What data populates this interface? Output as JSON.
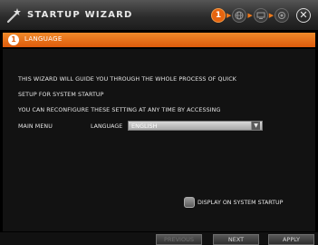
{
  "window": {
    "title": "STARTUP WIZARD",
    "close_symbol": "✕"
  },
  "steps": [
    {
      "label": "1",
      "icon": "step-1-icon",
      "active": true
    },
    {
      "icon": "globe-icon",
      "active": false
    },
    {
      "icon": "monitor-icon",
      "active": false
    },
    {
      "icon": "record-icon",
      "active": false
    }
  ],
  "section": {
    "badge": "1",
    "title": "LANGUAGE"
  },
  "description": [
    "THIS WIZARD WILL GUIDE YOU THROUGH THE WHOLE PROCESS OF QUICK",
    "SETUP FOR SYSTEM STARTUP",
    "YOU CAN RECONFIGURE THESE SETTING AT ANY TIME BY ACCESSING",
    "MAIN MENU"
  ],
  "language": {
    "label": "LANGUAGE",
    "value": "ENGLISH",
    "dropdown_symbol": "▼"
  },
  "startup_option": {
    "label": "DISPLAY ON SYSTEM STARTUP"
  },
  "buttons": {
    "previous": "PREVIOUS",
    "next": "NEXT",
    "apply": "APPLY"
  },
  "colors": {
    "accent": "#e6640f",
    "background": "#000000",
    "panel": "#121212"
  }
}
